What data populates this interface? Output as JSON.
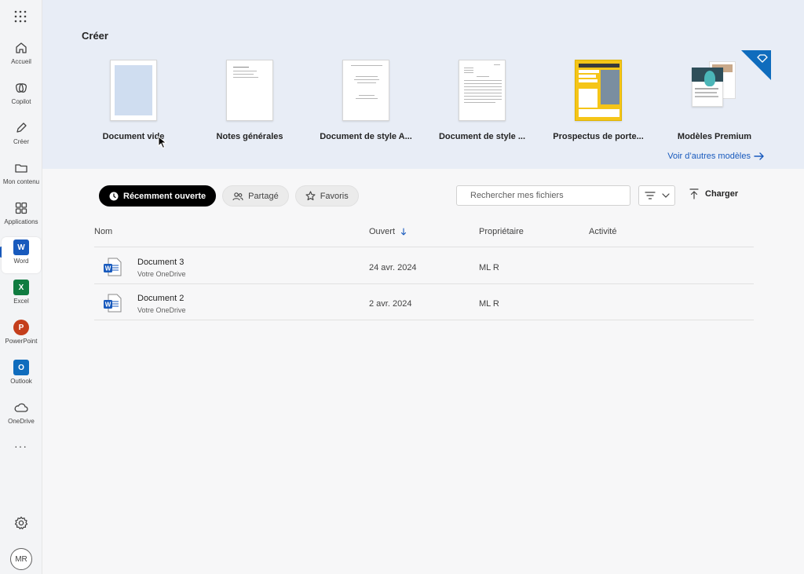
{
  "rail": {
    "items": [
      {
        "label": "Accueil",
        "icon": "home-icon"
      },
      {
        "label": "Copilot",
        "icon": "copilot-icon"
      },
      {
        "label": "Créer",
        "icon": "pen-icon"
      },
      {
        "label": "Mon contenu",
        "icon": "folder-icon"
      },
      {
        "label": "Applications",
        "icon": "apps-icon"
      },
      {
        "label": "Word",
        "icon": "word-icon"
      },
      {
        "label": "Excel",
        "icon": "excel-icon"
      },
      {
        "label": "PowerPoint",
        "icon": "powerpoint-icon"
      },
      {
        "label": "Outlook",
        "icon": "outlook-icon"
      },
      {
        "label": "OneDrive",
        "icon": "onedrive-icon"
      }
    ],
    "more": "···",
    "avatar": "MR"
  },
  "create": {
    "title": "Créer",
    "templates": [
      {
        "label": "Document vide"
      },
      {
        "label": "Notes générales"
      },
      {
        "label": "Document de style A..."
      },
      {
        "label": "Document de style ..."
      },
      {
        "label": "Prospectus de porte..."
      },
      {
        "label": "Modèles Premium"
      }
    ],
    "more_link": "Voir d’autres modèles"
  },
  "filters": {
    "recent": "Récemment ouverte",
    "shared": "Partagé",
    "favorites": "Favoris"
  },
  "search": {
    "placeholder": "Rechercher mes fichiers"
  },
  "upload": "Charger",
  "table": {
    "headers": {
      "name": "Nom",
      "opened": "Ouvert",
      "owner": "Propriétaire",
      "activity": "Activité"
    },
    "rows": [
      {
        "name": "Document 3",
        "location": "Votre OneDrive",
        "opened": "24 avr. 2024",
        "owner": "ML R"
      },
      {
        "name": "Document 2",
        "location": "Votre OneDrive",
        "opened": "2 avr. 2024",
        "owner": "ML R"
      }
    ]
  },
  "colors": {
    "word": "#185abd",
    "excel": "#107c41",
    "powerpoint": "#c43e1c",
    "outlook": "#0f6cbd",
    "create_band": "#e8edf6",
    "accent": "#185abd"
  }
}
